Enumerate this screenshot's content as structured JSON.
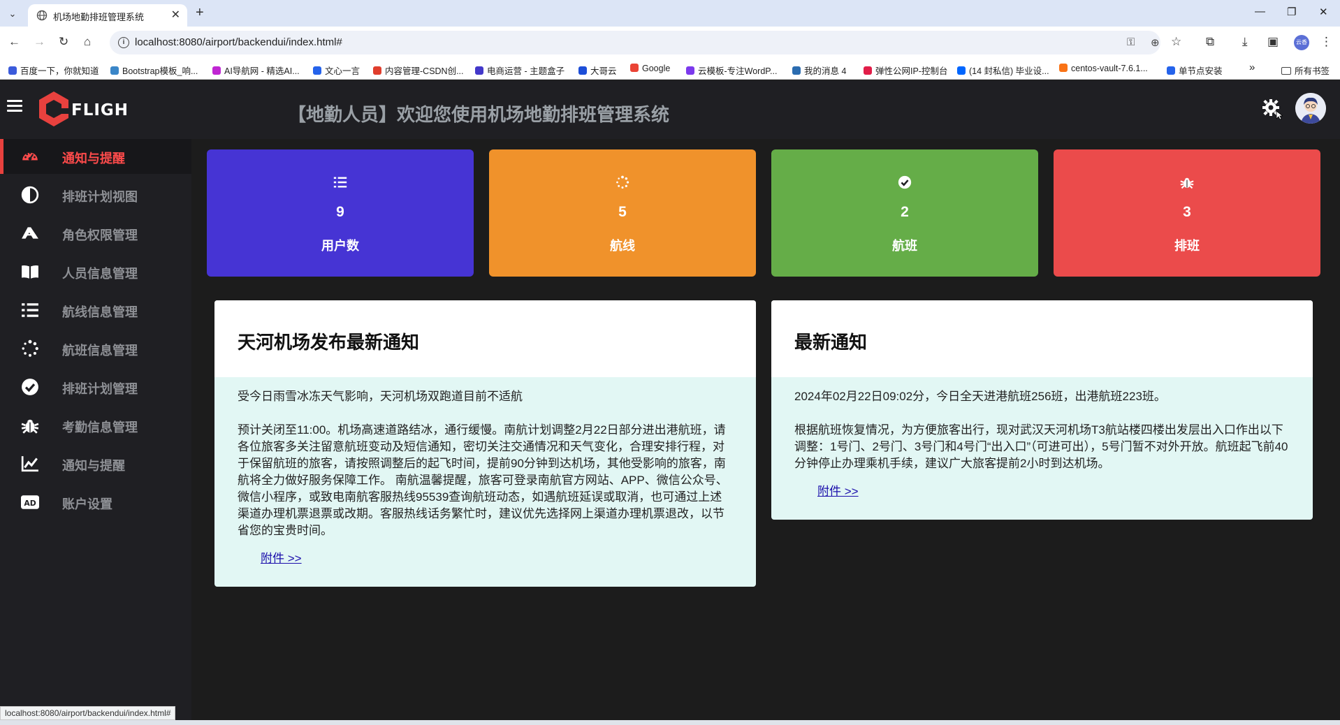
{
  "browser": {
    "tab_title": "机场地勤排班管理系统",
    "url": "localhost:8080/airport/backendui/index.html#",
    "status_url": "localhost:8080/airport/backendui/index.html#",
    "bookmarks": [
      {
        "label": "百度一下，你就知道",
        "color": "#3b5bdb"
      },
      {
        "label": "Bootstrap模板_响...",
        "color": "#3a86c8"
      },
      {
        "label": "AI导航网 - 精选AI...",
        "color": "#c026d3"
      },
      {
        "label": "文心一言",
        "color": "#2563eb"
      },
      {
        "label": "内容管理-CSDN创...",
        "color": "#e03e2d"
      },
      {
        "label": "电商运营 - 主题盒子",
        "color": "#4338ca"
      },
      {
        "label": "大哥云",
        "color": "#1d4ed8"
      },
      {
        "label": "Google",
        "color": "#ea4335"
      },
      {
        "label": "云模板-专注WordP...",
        "color": "#7c3aed"
      },
      {
        "label": "我的消息 4",
        "color": "#2b6cb0"
      },
      {
        "label": "弹性公网IP-控制台",
        "color": "#e11d48"
      },
      {
        "label": "(14 封私信) 毕业设...",
        "color": "#0066ff"
      },
      {
        "label": "centos-vault-7.6.1...",
        "color": "#f97316"
      },
      {
        "label": "单节点安装",
        "color": "#2563eb"
      }
    ],
    "all_bookmarks_label": "所有书签",
    "profile_label": "云香"
  },
  "header": {
    "logo_text": "FLIGH",
    "title": "【地勤人员】欢迎您使用机场地勤排班管理系统"
  },
  "sidebar": {
    "items": [
      {
        "label": "通知与提醒",
        "icon": "gauge-icon",
        "active": true
      },
      {
        "label": "排班计划视图",
        "icon": "contrast-icon",
        "active": false
      },
      {
        "label": "角色权限管理",
        "icon": "plane-icon",
        "active": false
      },
      {
        "label": "人员信息管理",
        "icon": "book-icon",
        "active": false
      },
      {
        "label": "航线信息管理",
        "icon": "list-icon",
        "active": false
      },
      {
        "label": "航班信息管理",
        "icon": "spinner-icon",
        "active": false
      },
      {
        "label": "排班计划管理",
        "icon": "check-circle-icon",
        "active": false
      },
      {
        "label": "考勤信息管理",
        "icon": "bug-icon",
        "active": false
      },
      {
        "label": "通知与提醒",
        "icon": "chart-line-icon",
        "active": false
      },
      {
        "label": "账户设置",
        "icon": "ad-icon",
        "active": false
      }
    ]
  },
  "stats": [
    {
      "value": "9",
      "label": "用户数",
      "color": "#4634d4",
      "icon": "list-icon"
    },
    {
      "value": "5",
      "label": "航线",
      "color": "#f0922b",
      "icon": "spinner-icon"
    },
    {
      "value": "2",
      "label": "航班",
      "color": "#65ad48",
      "icon": "check-circle-icon"
    },
    {
      "value": "3",
      "label": "排班",
      "color": "#eb4b4b",
      "icon": "bug-icon"
    }
  ],
  "notices": [
    {
      "title": "天河机场发布最新通知",
      "paragraphs": [
        "受今日雨雪冰冻天气影响，天河机场双跑道目前不适航",
        "预计关闭至11:00。机场高速道路结冰，通行缓慢。南航计划调整2月22日部分进出港航班，请各位旅客多关注留意航班变动及短信通知，密切关注交通情况和天气变化，合理安排行程，对于保留航班的旅客，请按照调整后的起飞时间，提前90分钟到达机场，其他受影响的旅客，南航将全力做好服务保障工作。 南航温馨提醒，旅客可登录南航官方网站、APP、微信公众号、微信小程序，或致电南航客服热线95539查询航班动态，如遇航班延误或取消，也可通过上述渠道办理机票退票或改期。客服热线话务繁忙时，建议优先选择网上渠道办理机票退改，以节省您的宝贵时间。"
      ],
      "link": "附件 >>"
    },
    {
      "title": "最新通知",
      "paragraphs": [
        "2024年02月22日09:02分，今日全天进港航班256班，出港航班223班。",
        "根据航班恢复情况，为方便旅客出行，现对武汉天河机场T3航站楼四楼出发层出入口作出以下调整：1号门、2号门、3号门和4号门“出入口”（可进可出），5号门暂不对外开放。航班起飞前40分钟停止办理乘机手续，建议广大旅客提前2小时到达机场。"
      ],
      "link": "附件 >>"
    }
  ]
}
